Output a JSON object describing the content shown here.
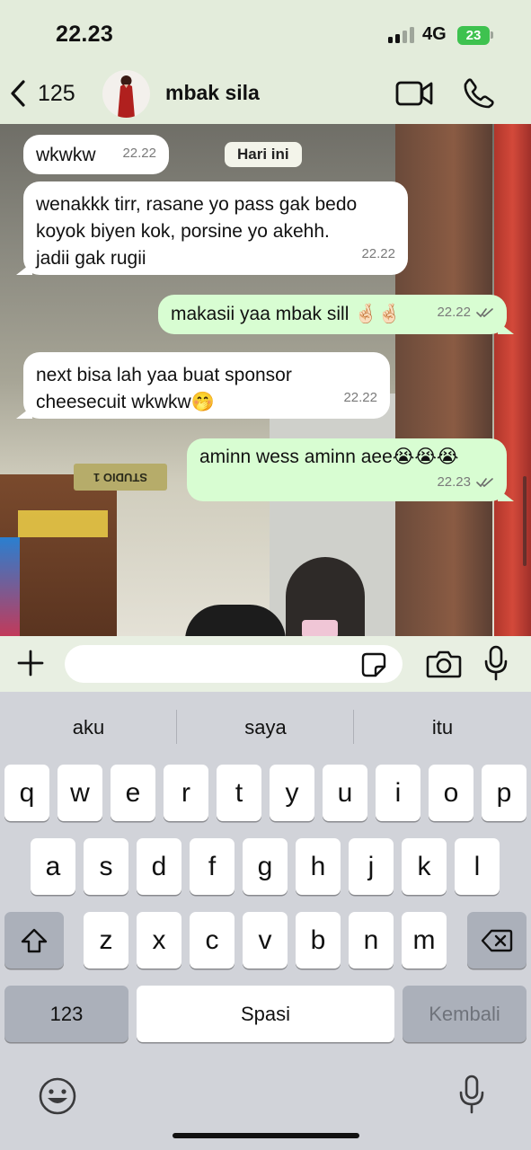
{
  "status_bar": {
    "time": "22.23",
    "network": "4G",
    "battery": "23"
  },
  "header": {
    "back_count": "125",
    "contact_name": "mbak sila"
  },
  "chat": {
    "date_label": "Hari ini",
    "messages": [
      {
        "dir": "in",
        "text": "wkwkw",
        "time": "22.22"
      },
      {
        "dir": "in",
        "text": "wenakkk tirr, rasane yo pass gak bedo\nkoyok biyen kok, porsine yo akehh.\njadii gak rugii",
        "time": "22.22"
      },
      {
        "dir": "out",
        "text": "makasii yaa mbak sill 🤞🏻🤞🏻",
        "time": "22.22"
      },
      {
        "dir": "in",
        "text": "next bisa lah yaa buat sponsor\ncheesecuit wkwkw🤭",
        "time": "22.22"
      },
      {
        "dir": "out",
        "text": "aminn wess aminn aee😭😭😭",
        "time": "22.23"
      }
    ],
    "background_sign": "STUDIO 1"
  },
  "input": {
    "placeholder": ""
  },
  "keyboard": {
    "suggestions": [
      "aku",
      "saya",
      "itu"
    ],
    "row1": [
      "q",
      "w",
      "e",
      "r",
      "t",
      "y",
      "u",
      "i",
      "o",
      "p"
    ],
    "row2": [
      "a",
      "s",
      "d",
      "f",
      "g",
      "h",
      "j",
      "k",
      "l"
    ],
    "row3": [
      "z",
      "x",
      "c",
      "v",
      "b",
      "n",
      "m"
    ],
    "numbers_key": "123",
    "space_key": "Spasi",
    "return_key": "Kembali"
  },
  "colors": {
    "incoming_bubble": "#ffffff",
    "outgoing_bubble": "#d8fdd2",
    "header_bg": "#e3ecdb",
    "battery": "#3ec24f"
  }
}
